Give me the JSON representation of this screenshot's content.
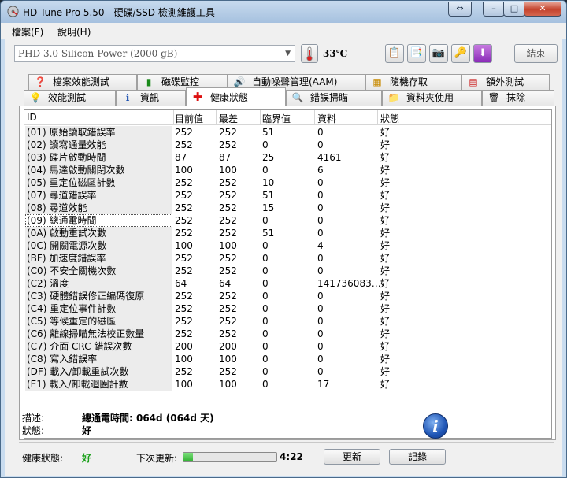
{
  "window": {
    "title": "HD Tune Pro 5.50 - 硬碟/SSD 檢測維護工具"
  },
  "menu": [
    "檔案(F)",
    "說明(H)"
  ],
  "toolbar": {
    "drive": "PHD 3.0 Silicon-Power (2000 gB)",
    "temperature": "33℃",
    "exit_label": "結束",
    "icons": [
      "copy-text-icon",
      "copy-screen-icon",
      "camera-icon",
      "options-icon",
      "download-icon"
    ]
  },
  "tabs_row1": [
    {
      "label": "檔案效能測試",
      "icon": "file-benchmark-icon"
    },
    {
      "label": "磁碟監控",
      "icon": "disk-monitor-icon"
    },
    {
      "label": "自動噪聲管理(AAM)",
      "icon": "speaker-icon"
    },
    {
      "label": "隨機存取",
      "icon": "random-access-icon"
    },
    {
      "label": "額外測試",
      "icon": "extra-tests-icon"
    }
  ],
  "tabs_row2": [
    {
      "label": "效能測試",
      "icon": "benchmark-icon"
    },
    {
      "label": "資訊",
      "icon": "info-icon"
    },
    {
      "label": "健康狀態",
      "icon": "health-cross-icon",
      "active": true
    },
    {
      "label": "錯誤掃瞄",
      "icon": "magnifier-icon"
    },
    {
      "label": "資料夾使用",
      "icon": "folder-icon"
    },
    {
      "label": "抹除",
      "icon": "trash-icon"
    }
  ],
  "table": {
    "columns": [
      "ID",
      "目前值",
      "最差",
      "臨界值",
      "資料",
      "狀態"
    ],
    "rows": [
      [
        "(01) 原始讀取錯誤率",
        "252",
        "252",
        "51",
        "0",
        "好"
      ],
      [
        "(02) 讀寫通量效能",
        "252",
        "252",
        "0",
        "0",
        "好"
      ],
      [
        "(03) 碟片啟動時間",
        "87",
        "87",
        "25",
        "4161",
        "好"
      ],
      [
        "(04) 馬達啟動關閉次數",
        "100",
        "100",
        "0",
        "6",
        "好"
      ],
      [
        "(05) 重定位磁區計數",
        "252",
        "252",
        "10",
        "0",
        "好"
      ],
      [
        "(07) 尋道錯誤率",
        "252",
        "252",
        "51",
        "0",
        "好"
      ],
      [
        "(08) 尋道效能",
        "252",
        "252",
        "15",
        "0",
        "好"
      ],
      [
        "(09) 總通電時間",
        "252",
        "252",
        "0",
        "0",
        "好"
      ],
      [
        "(0A) 啟動重試次數",
        "252",
        "252",
        "51",
        "0",
        "好"
      ],
      [
        "(0C) 開關電源次數",
        "100",
        "100",
        "0",
        "4",
        "好"
      ],
      [
        "(BF) 加速度錯誤率",
        "252",
        "252",
        "0",
        "0",
        "好"
      ],
      [
        "(C0) 不安全關機次數",
        "252",
        "252",
        "0",
        "0",
        "好"
      ],
      [
        "(C2) 溫度",
        "64",
        "64",
        "0",
        "141736083…",
        "好"
      ],
      [
        "(C3) 硬體錯誤修正編碼復原",
        "252",
        "252",
        "0",
        "0",
        "好"
      ],
      [
        "(C4) 重定位事件計數",
        "252",
        "252",
        "0",
        "0",
        "好"
      ],
      [
        "(C5) 等候重定的磁區",
        "252",
        "252",
        "0",
        "0",
        "好"
      ],
      [
        "(C6) 離線掃瞄無法校正數量",
        "252",
        "252",
        "0",
        "0",
        "好"
      ],
      [
        "(C7) 介面 CRC 錯誤次數",
        "200",
        "200",
        "0",
        "0",
        "好"
      ],
      [
        "(C8) 寫入錯誤率",
        "100",
        "100",
        "0",
        "0",
        "好"
      ],
      [
        "(DF) 載入/卸載重試次數",
        "252",
        "252",
        "0",
        "0",
        "好"
      ],
      [
        "(E1) 載入/卸載迴圈計數",
        "100",
        "100",
        "0",
        "17",
        "好"
      ]
    ],
    "selected_index": 7
  },
  "details": {
    "desc_label": "描述:",
    "desc_value": "總通電時間: 064d (064d 天)",
    "status_label": "狀態:",
    "status_value": "好"
  },
  "footer": {
    "health_label": "健康狀態:",
    "health_value": "好",
    "next_update_label": "下次更新:",
    "progress_fraction": 0.1,
    "countdown": "4:22",
    "refresh_label": "更新",
    "log_label": "記錄"
  },
  "colors": {
    "health_good": "#1aa01a",
    "title_gradient_top": "#c7daee",
    "close_red": "#c4432d"
  }
}
